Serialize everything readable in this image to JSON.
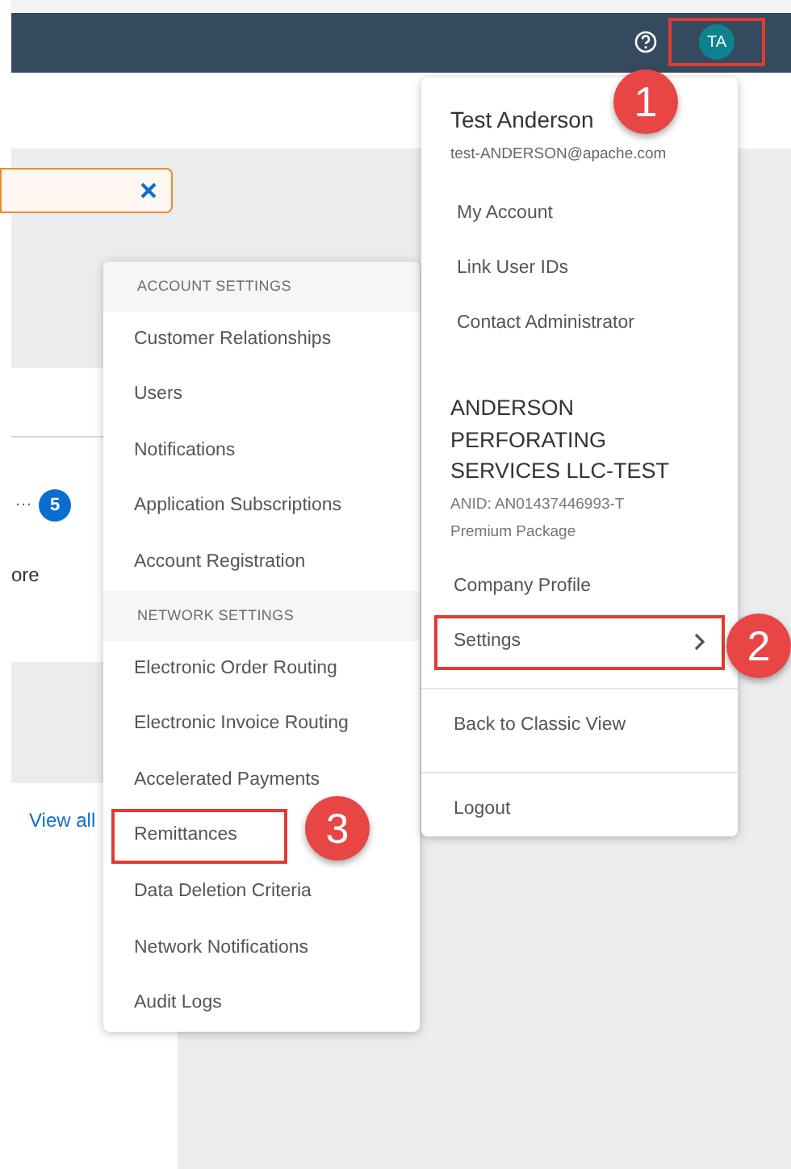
{
  "header": {
    "avatar": {
      "initials": "TA",
      "highlighted": true
    }
  },
  "page": {
    "ellipsis": "…",
    "badge": "5",
    "truncated_text": "ore",
    "link": "View all"
  },
  "profile_menu": {
    "name": "Test Anderson",
    "email": "test-ANDERSON@apache.com",
    "account_items": [
      {
        "label": "My Account"
      },
      {
        "label": "Link User IDs"
      },
      {
        "label": "Contact Administrator"
      }
    ],
    "company": {
      "name": "ANDERSON PERFORATING SERVICES LLC-TEST",
      "anid": "ANID: AN01437446993-T",
      "package": "Premium Package"
    },
    "company_items": [
      {
        "label": "Company Profile",
        "has_submenu": false,
        "highlighted": false
      },
      {
        "label": "Settings",
        "has_submenu": true,
        "highlighted": true
      }
    ],
    "footer_items": [
      {
        "label": "Back to Classic View"
      },
      {
        "label": "Logout"
      }
    ]
  },
  "settings_menu": {
    "sections": [
      {
        "heading": "ACCOUNT SETTINGS",
        "items": [
          {
            "label": "Customer Relationships",
            "highlighted": false
          },
          {
            "label": "Users",
            "highlighted": false
          },
          {
            "label": "Notifications",
            "highlighted": false
          },
          {
            "label": "Application Subscriptions",
            "highlighted": false
          },
          {
            "label": "Account Registration",
            "highlighted": false
          }
        ]
      },
      {
        "heading": "NETWORK SETTINGS",
        "items": [
          {
            "label": "Electronic Order Routing",
            "highlighted": false
          },
          {
            "label": "Electronic Invoice Routing",
            "highlighted": false
          },
          {
            "label": "Accelerated Payments",
            "highlighted": false
          },
          {
            "label": "Remittances",
            "highlighted": true
          },
          {
            "label": "Data Deletion Criteria",
            "highlighted": false
          },
          {
            "label": "Network Notifications",
            "highlighted": false
          },
          {
            "label": "Audit Logs",
            "highlighted": false
          }
        ]
      }
    ]
  },
  "callouts": [
    "1",
    "2",
    "3"
  ]
}
